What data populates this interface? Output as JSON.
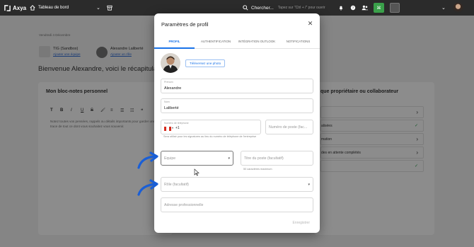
{
  "topbar": {
    "logo": "Axya",
    "board": "Tableau de bord",
    "search_label": "Chercher...",
    "search_hint": "Tapez sur \"Ctrl + /\" pour ouvrir",
    "chip": "⌘",
    "colors": {
      "bar": "#2b2b2b",
      "chip": "#3aa04a"
    }
  },
  "dashboard": {
    "date": "Vendredi 4 Décembre",
    "company": {
      "name": "TIG (Sandbox)",
      "link": "Ajouter une équipe"
    },
    "user": {
      "name": "Alexandre Laliberté",
      "link": "Ajouter un rôle"
    },
    "welcome": "Bienvenue Alexandre, voici le récapitulatif d",
    "notepad": {
      "title": "Mon bloc-notes personnel",
      "toolbar": [
        "T",
        "B",
        "I",
        "U",
        "S",
        "🖌",
        "≡",
        "☰",
        "☷",
        "❝"
      ],
      "text": "Notez toutes vos pensées, rappels ou détails importants pour garder une trace de tout ce dont vous souhaitez vous souvenir."
    },
    "right_panel": {
      "title": "que propriétaire ou collaborateur",
      "rows": [
        "",
        "alisées",
        "mation",
        "des en attente complétés",
        ""
      ]
    }
  },
  "modal": {
    "title": "Paramètres de profil",
    "tabs": [
      "PROFIL",
      "AUTHENTIFICATION",
      "INTÉGRATION OUTLOOK",
      "NOTIFICATIONS"
    ],
    "active_tab": "PROFIL",
    "upload_label": "Téléversez une photo",
    "first_name": {
      "label": "Prénom",
      "value": "Alexandre"
    },
    "last_name": {
      "label": "Nom",
      "value": "Laliberté"
    },
    "phone": {
      "label": "Numéro de téléphone",
      "code": "+1",
      "placeholder": "Numéro de poste (fac...",
      "helper": "Sera utilisé pour les signatures au lieu du numéro de téléphone de l'entreprise"
    },
    "team": {
      "placeholder": "Equipe"
    },
    "job_title": {
      "placeholder": "Titre du poste (facultatif)",
      "helper": "50 caractères maximum"
    },
    "role": {
      "placeholder": "Rôle (facultatif)"
    },
    "address": {
      "placeholder": "Adresse professionnelle"
    },
    "save_label": "Enregistrer",
    "colors": {
      "accent": "#1a73e8"
    }
  },
  "annotations": {
    "arrow_color": "#1a5fd6"
  }
}
